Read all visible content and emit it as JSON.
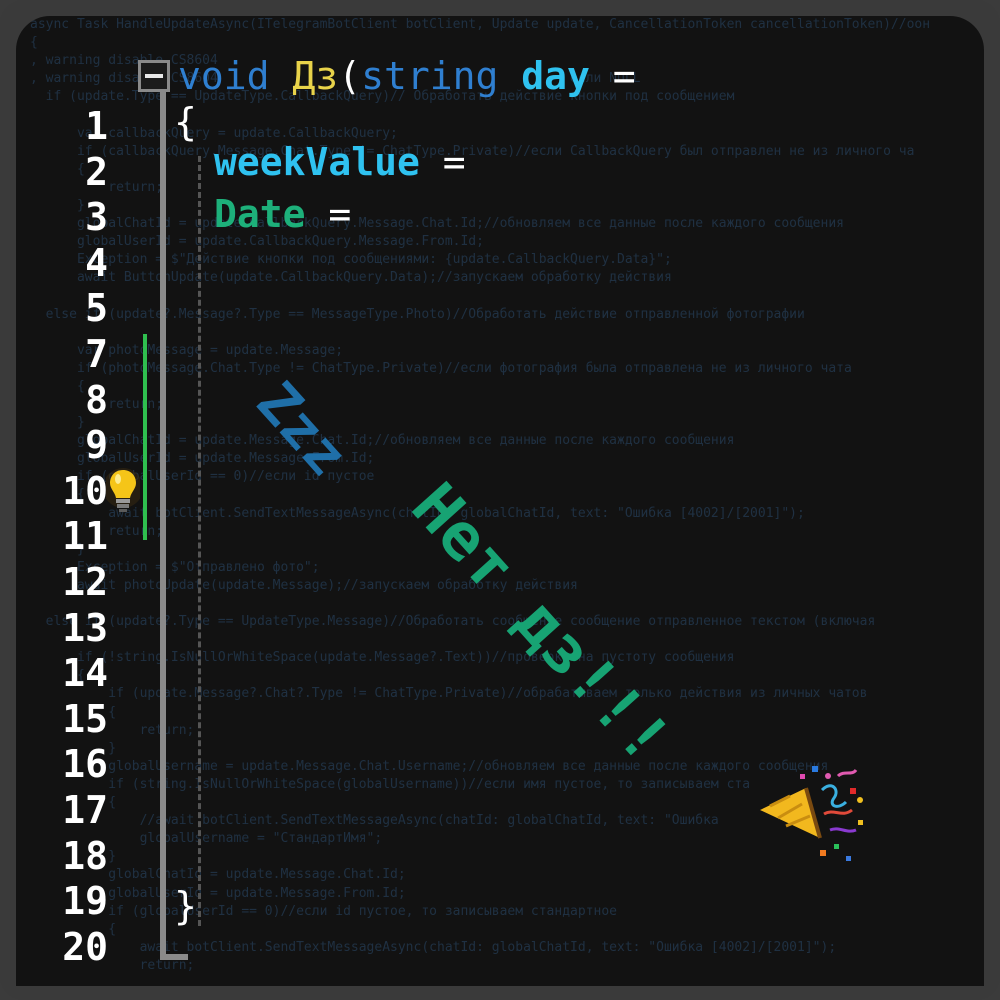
{
  "editor": {
    "line_numbers": [
      "1",
      "2",
      "3",
      "4",
      "5",
      "7",
      "8",
      "9",
      "10",
      "11",
      "12",
      "13",
      "14",
      "15",
      "16",
      "17",
      "18",
      "19",
      "20"
    ],
    "signature": {
      "keyword": "void",
      "name": "Дз",
      "paren_open": "(",
      "param_type": "string",
      "param_name": "day",
      "equals": " ="
    },
    "brace_open": "{",
    "brace_close": "}",
    "collapse_symbol": "−",
    "week_line": {
      "name": "weekValue",
      "equals": " ="
    },
    "date_line": {
      "name": "Date",
      "equals": " ="
    },
    "overlay_zzz": "Zzz",
    "overlay_message": "Нет дз!!!",
    "icons": {
      "lightbulb": "lightbulb-icon",
      "party": "party-popper-icon"
    },
    "colors": {
      "keyword": "#2f7fd0",
      "function": "#e8d34a",
      "variable": "#2fc2f0",
      "teal": "#1db07a",
      "zzz": "#1f6fa8",
      "message": "#17a373"
    }
  },
  "background_code": [
    "async Task HandleUpdateAsync(ITelegramBotClient botClient, Update update, CancellationToken cancellationToken)//оон",
    "{",
    ", warning disable CS8604",
    ", warning disable CS8604                                             если NULL",
    "  if (update.Type == UpdateType.CallbackQuery)// Обработать действие кнопки под сообщением",
    "",
    "      var callbackQuery = update.CallbackQuery;",
    "      if (callbackQuery.Message.Chat.Type != ChatType.Private)//если CallbackQuery был отправлен не из личного ча",
    "      {",
    "          return;",
    "      }",
    "      globalChatId = update.CallbackQuery.Message.Chat.Id;//обновляем все данные после каждого сообщения",
    "      globalUserId = update.CallbackQuery.Message.From.Id;",
    "      Exception = $\"Действие кнопки под сообщениями: {update.CallbackQuery.Data}\";",
    "      await ButtonUpdate(update.CallbackQuery.Data);//запускаем обработку действия",
    "",
    "  else if (update?.Message?.Type == MessageType.Photo)//Обработать действие отправленной фотографии",
    "",
    "      var photoMessage = update.Message;",
    "      if (photoMessage.Chat.Type != ChatType.Private)//если фотография была отправлена не из личного чата",
    "      {",
    "          return;",
    "      }",
    "      globalChatId = update.Message.Chat.Id;//обновляем все данные после каждого сообщения",
    "      globalUserId = update.Message.From.Id;",
    "      if (globalUserId == 0)//если id пустое",
    "      {",
    "          await botClient.SendTextMessageAsync(chatId: globalChatId, text: \"Ошибка [4002]/[2001]\");",
    "          return;",
    "      }",
    "      Exception = $\"Отправлено фото\";",
    "      await photoUpdate(update.Message);//запускаем обработку действия",
    "",
    "  else if (update?.Type == UpdateType.Message)//Обработать сообщение сообщение отправленное текстом (включая",
    "",
    "      if (!string.IsNullOrWhiteSpace(update.Message?.Text))//проверка на пустоту сообщения",
    "      {",
    "          if (update.Message?.Chat?.Type != ChatType.Private)//обрабатываем только действия из личных чатов",
    "          {",
    "              return;",
    "          }",
    "          globalUsername = update.Message.Chat.Username;//обновляем все данные после каждого сообщения",
    "          if (string.IsNullOrWhiteSpace(globalUsername))//если имя пустое, то записываем ста",
    "          {",
    "              //await botClient.SendTextMessageAsync(chatId: globalChatId, text: \"Ошибка",
    "              globalUsername = \"СтандартИмя\";",
    "          }",
    "          globalChatId = update.Message.Chat.Id;",
    "          globalUserId = update.Message.From.Id;",
    "          if (globalUserId == 0)//если id пустое, то записываем стандартное",
    "          {",
    "              await botClient.SendTextMessageAsync(chatId: globalChatId, text: \"Ошибка [4002]/[2001]\");",
    "              return;"
  ]
}
